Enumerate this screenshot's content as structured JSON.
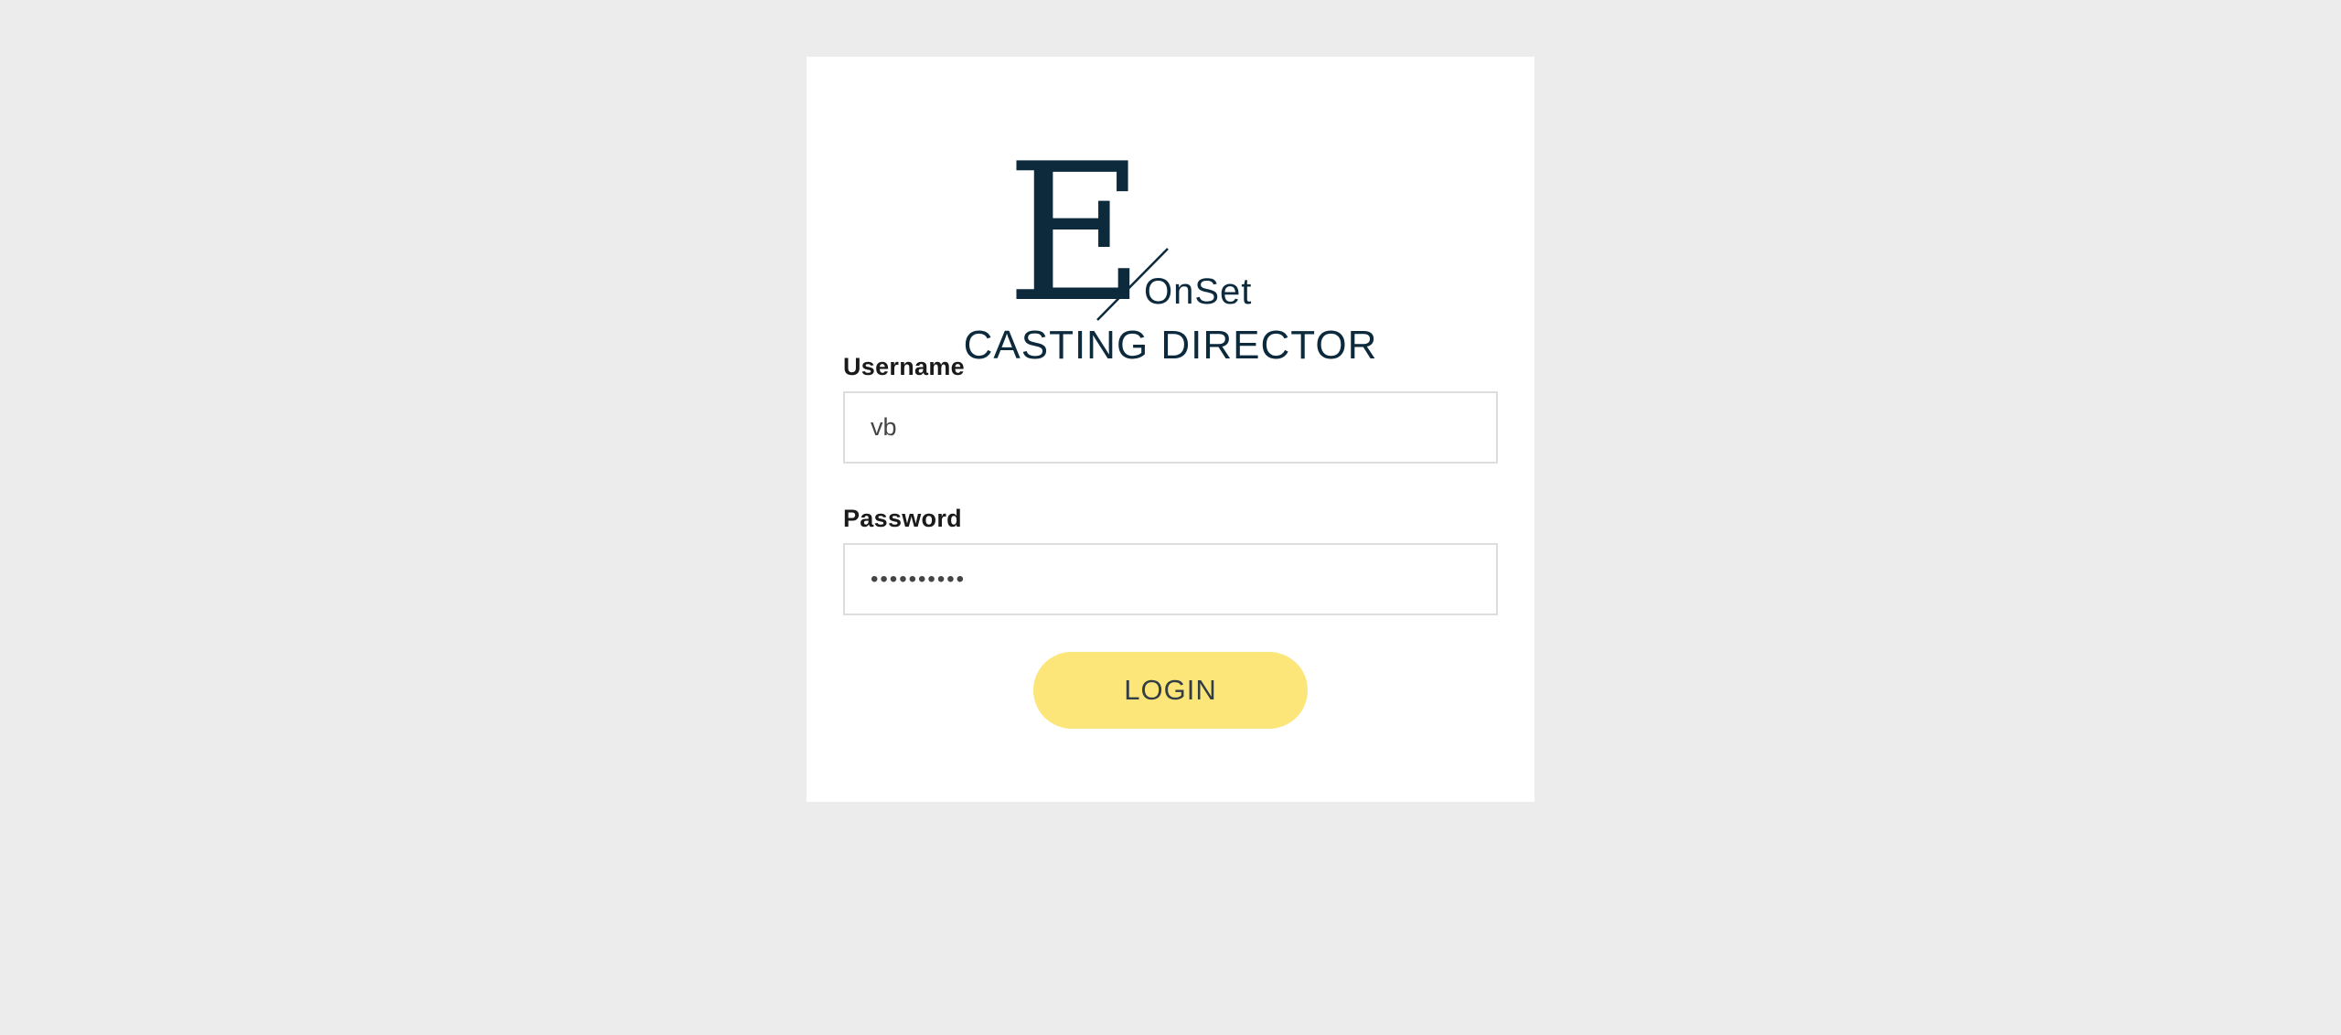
{
  "brand": {
    "logo_letter": "E",
    "logo_word": "OnSet",
    "tagline": "CASTING DIRECTOR",
    "color": "#0c2a3c"
  },
  "form": {
    "username_label": "Username",
    "username_value": "vb",
    "password_label": "Password",
    "password_value": "••••••••••",
    "login_label": "LOGIN"
  },
  "colors": {
    "background": "#ececec",
    "card": "#ffffff",
    "button": "#fce579",
    "input_border": "#dddddd"
  }
}
